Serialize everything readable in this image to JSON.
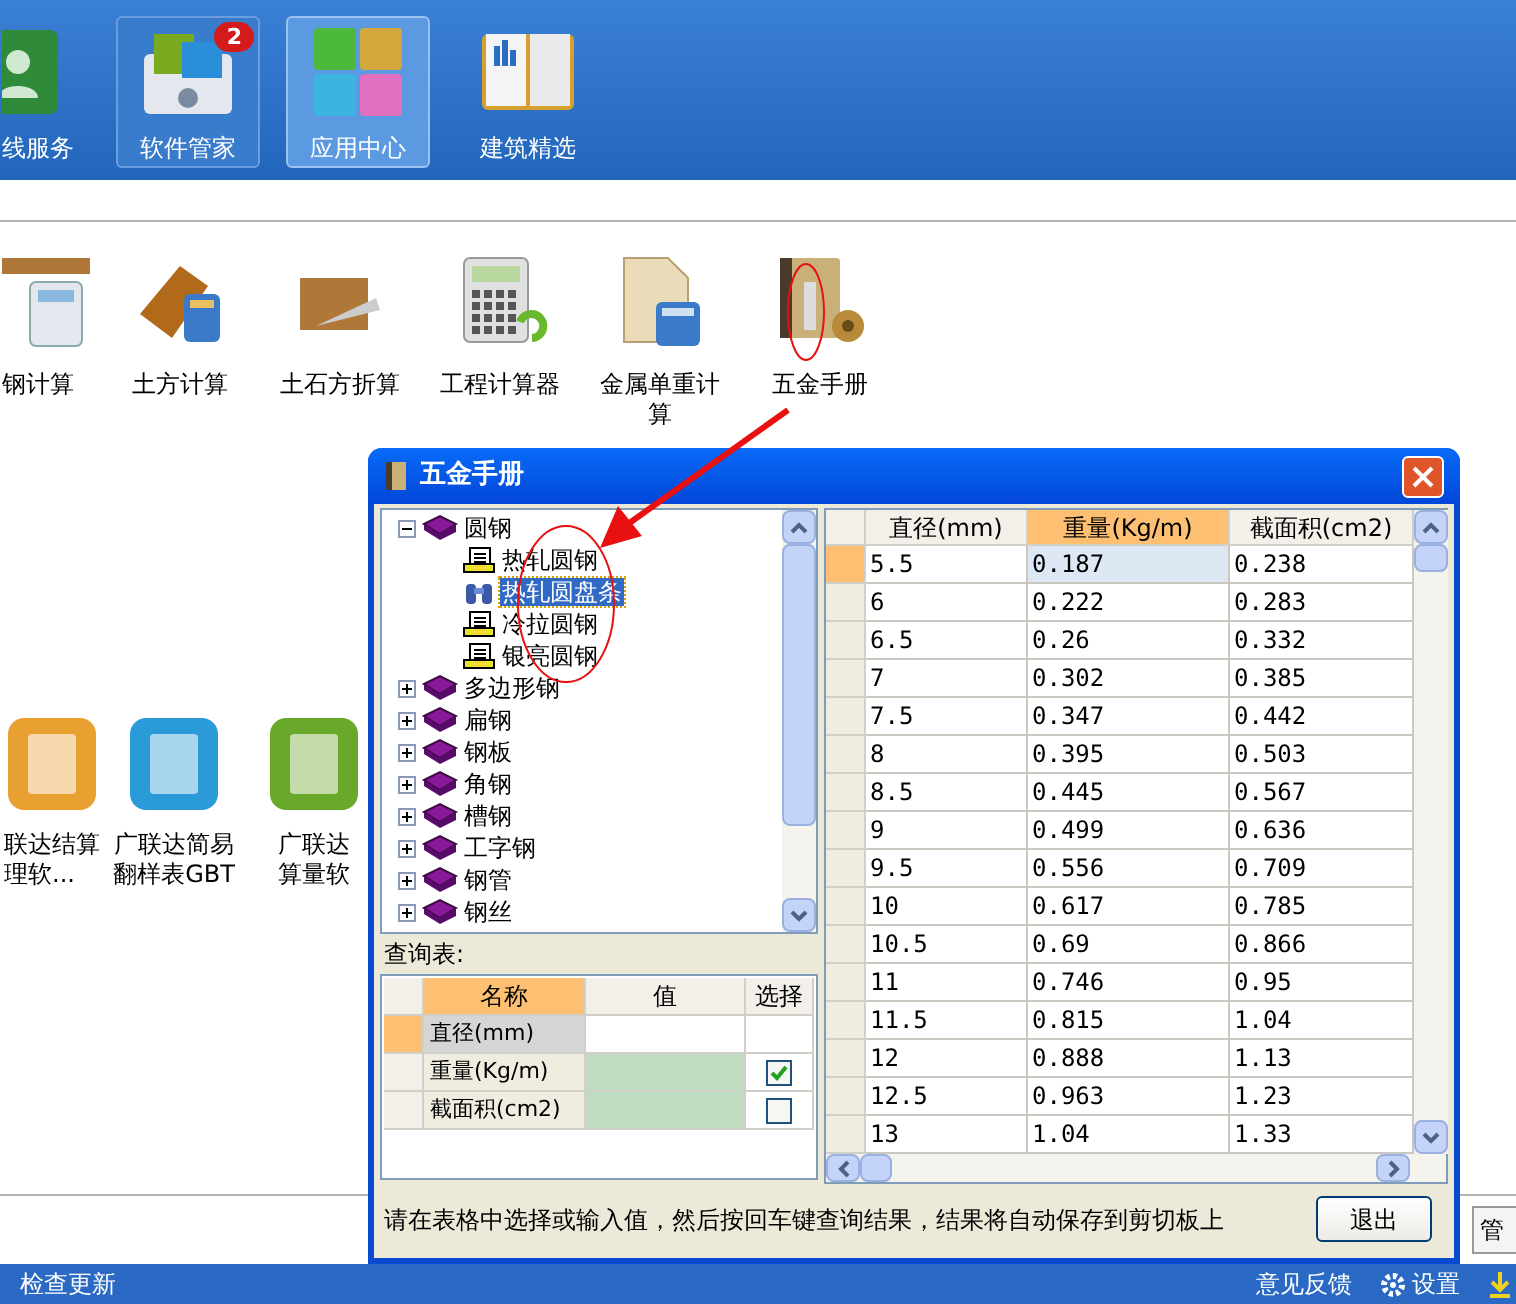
{
  "top_nav": [
    {
      "label": "线服务",
      "selected": false
    },
    {
      "label": "软件管家",
      "selected": false,
      "badge": "2"
    },
    {
      "label": "应用中心",
      "selected": true
    },
    {
      "label": "建筑精选",
      "selected": false
    }
  ],
  "tools": [
    {
      "label": "钢计算"
    },
    {
      "label": "土方计算"
    },
    {
      "label": "土石方折算"
    },
    {
      "label": "工程计算器"
    },
    {
      "label": "金属单重计算"
    },
    {
      "label": "五金手册"
    }
  ],
  "apps": [
    {
      "lines": [
        "联达结算",
        "理软..."
      ]
    },
    {
      "lines": [
        "广联达简易",
        "翻样表GBT"
      ]
    },
    {
      "lines": [
        "广联达",
        "算量软"
      ]
    }
  ],
  "manage_button": "管",
  "status_bar": {
    "left": "检查更新",
    "feedback": "意见反馈",
    "settings": "设置"
  },
  "dialog": {
    "title": "五金手册",
    "tree": [
      {
        "label": "圆钢",
        "expanded": true,
        "children": [
          {
            "label": "热轧圆钢",
            "selected": false
          },
          {
            "label": "热轧圆盘条",
            "selected": true
          },
          {
            "label": "冷拉圆钢",
            "selected": false
          },
          {
            "label": "银亮圆钢",
            "selected": false
          }
        ]
      },
      {
        "label": "多边形钢",
        "expanded": false
      },
      {
        "label": "扁钢",
        "expanded": false
      },
      {
        "label": "钢板",
        "expanded": false
      },
      {
        "label": "角钢",
        "expanded": false
      },
      {
        "label": "槽钢",
        "expanded": false
      },
      {
        "label": "工字钢",
        "expanded": false
      },
      {
        "label": "钢管",
        "expanded": false
      },
      {
        "label": "钢丝",
        "expanded": false
      }
    ],
    "query_label": "查询表:",
    "query_table": {
      "columns": [
        {
          "label": "名称",
          "selected": true
        },
        {
          "label": "值",
          "selected": false
        },
        {
          "label": "选择",
          "selected": false
        }
      ],
      "rows": [
        {
          "name": "直径(mm)",
          "kind": "input",
          "selected": true
        },
        {
          "name": "重量(Kg/m)",
          "kind": "result",
          "selected": false,
          "checked": true
        },
        {
          "name": "截面积(cm2)",
          "kind": "result",
          "selected": false,
          "checked": false
        }
      ]
    },
    "table": {
      "columns": [
        {
          "label": "直径(mm)",
          "selected": false
        },
        {
          "label": "重量(Kg/m)",
          "selected": true
        },
        {
          "label": "截面积(cm2)",
          "selected": false
        }
      ],
      "rows": [
        {
          "cells": [
            "5.5",
            "0.187",
            "0.238"
          ],
          "selected": true
        },
        {
          "cells": [
            "6",
            "0.222",
            "0.283"
          ],
          "selected": false
        },
        {
          "cells": [
            "6.5",
            "0.26",
            "0.332"
          ],
          "selected": false
        },
        {
          "cells": [
            "7",
            "0.302",
            "0.385"
          ],
          "selected": false
        },
        {
          "cells": [
            "7.5",
            "0.347",
            "0.442"
          ],
          "selected": false
        },
        {
          "cells": [
            "8",
            "0.395",
            "0.503"
          ],
          "selected": false
        },
        {
          "cells": [
            "8.5",
            "0.445",
            "0.567"
          ],
          "selected": false
        },
        {
          "cells": [
            "9",
            "0.499",
            "0.636"
          ],
          "selected": false
        },
        {
          "cells": [
            "9.5",
            "0.556",
            "0.709"
          ],
          "selected": false
        },
        {
          "cells": [
            "10",
            "0.617",
            "0.785"
          ],
          "selected": false
        },
        {
          "cells": [
            "10.5",
            "0.69",
            "0.866"
          ],
          "selected": false
        },
        {
          "cells": [
            "11",
            "0.746",
            "0.95"
          ],
          "selected": false
        },
        {
          "cells": [
            "11.5",
            "0.815",
            "1.04"
          ],
          "selected": false
        },
        {
          "cells": [
            "12",
            "0.888",
            "1.13"
          ],
          "selected": false
        },
        {
          "cells": [
            "12.5",
            "0.963",
            "1.23"
          ],
          "selected": false
        },
        {
          "cells": [
            "13",
            "1.04",
            "1.33"
          ],
          "selected": false
        }
      ]
    },
    "hint": "请在表格中选择或输入值，然后按回车键查询结果，结果将自动保存到剪切板上",
    "exit_button": "退出"
  }
}
